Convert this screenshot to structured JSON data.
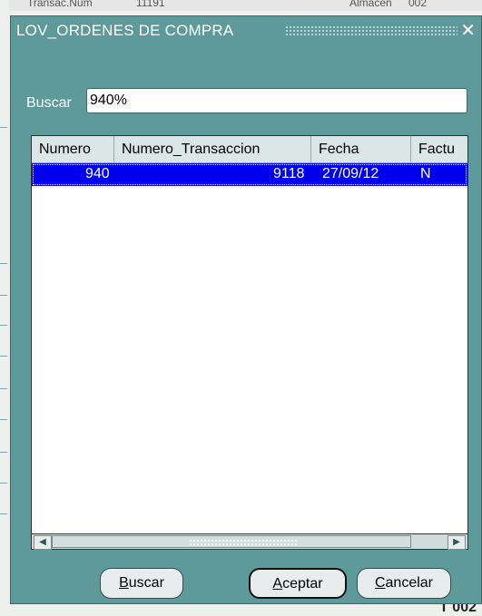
{
  "background": {
    "top_labels": [
      "Transac.Num",
      "11191",
      "Almacen",
      "002"
    ],
    "bottom_text": "T 002"
  },
  "dialog": {
    "title": "LOV_ORDENES DE COMPRA",
    "close_symbol": "✕",
    "search": {
      "label": "Buscar",
      "value": "940%"
    },
    "table": {
      "columns": [
        "Numero",
        "Numero_Transaccion",
        "Fecha",
        "Factu"
      ],
      "rows": [
        {
          "numero": "940",
          "numero_transaccion": "9118",
          "fecha": "27/09/12",
          "factura": "N"
        }
      ]
    },
    "buttons": {
      "buscar": {
        "label": "Buscar",
        "mnemonic": "B",
        "rest": "uscar"
      },
      "aceptar": {
        "label": "Aceptar",
        "mnemonic": "A",
        "rest": "ceptar"
      },
      "cancelar": {
        "label": "Cancelar",
        "mnemonic": "C",
        "rest": "ancelar"
      }
    }
  },
  "colors": {
    "dialog_bg": "#5f9a9b",
    "selection": "#0000ee"
  }
}
